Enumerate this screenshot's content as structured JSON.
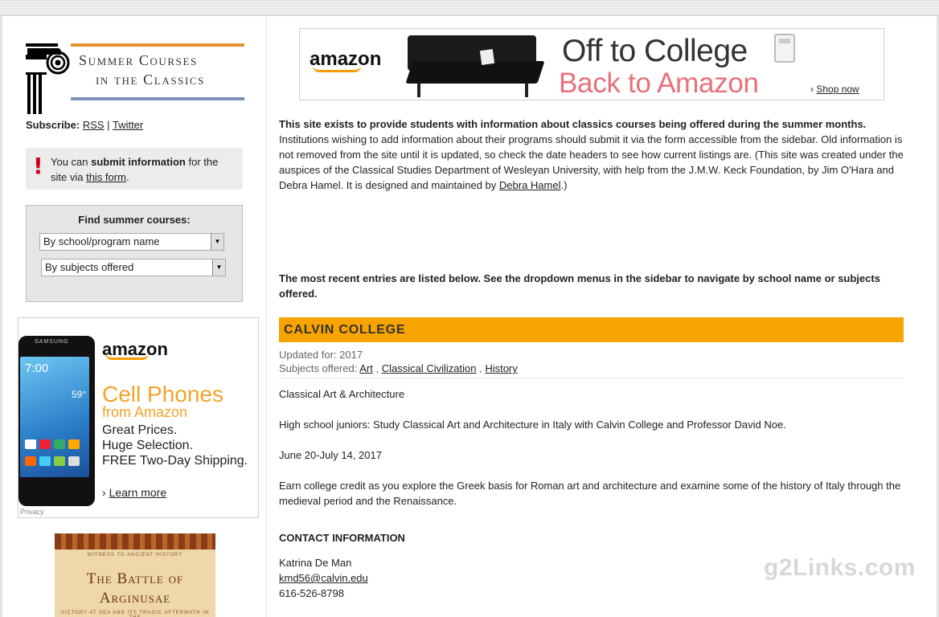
{
  "header": {
    "logo_line1": "Summer Courses",
    "logo_line2": "in the Classics"
  },
  "subscribe": {
    "label": "Subscribe:",
    "rss": "RSS",
    "separator": "|",
    "twitter": "Twitter"
  },
  "notice": {
    "text_pre": "You can",
    "text_bold": "submit information",
    "text_mid": "for the site via",
    "link": "this form",
    "text_post": "."
  },
  "finder": {
    "title": "Find summer courses:",
    "select_school": "By school/program name",
    "select_subjects": "By subjects offered"
  },
  "sidebar_ad": {
    "brand": "amazon",
    "phone_brand": "SAMSUNG",
    "phone_time": "7:00",
    "phone_temp": "59°",
    "headline": "Cell Phones",
    "sub": "from Amazon",
    "line1": "Great Prices.",
    "line2": "Huge Selection.",
    "line3": "FREE Two-Day Shipping.",
    "cta": "Learn more",
    "privacy": "Privacy"
  },
  "book": {
    "series": "WITNESS TO ANCIENT HISTORY",
    "title1": "The Battle of",
    "title2": "Arginusae",
    "desc": "VICTORY AT SEA AND ITS TRAGIC AFTERMATH IN THE"
  },
  "top_ad": {
    "brand": "amazon",
    "line1": "Off to College",
    "line2": "Back to Amazon",
    "cta": "Shop now"
  },
  "intro": {
    "bold": "This site exists to provide students with information about classics courses being offered during the summer months.",
    "body": "Institutions wishing to add information about their programs should submit it via the form accessible from the sidebar. Old information is not removed from the site until it is updated, so check the date headers to see how current listings are. (This site was created under the auspices of the Classical Studies Department of Wesleyan University, with help from the J.M.W. Keck Foundation, by Jim O'Hara and Debra Hamel. It is designed and maintained by",
    "link": "Debra Hamel",
    "end": ".)"
  },
  "recent_note": "The most recent entries are listed below. See the dropdown menus in the sidebar to navigate by school name or subjects offered.",
  "entry": {
    "title": "CALVIN COLLEGE",
    "updated_label": "Updated for:",
    "updated_value": "2017",
    "subjects_label": "Subjects offered:",
    "subjects": [
      "Art",
      "Classical Civilization",
      "History"
    ],
    "p1": "Classical Art & Architecture",
    "p2": "High school juniors: Study Classical Art and Architecture in Italy with Calvin College and Professor David Noe.",
    "p3": "June 20-July 14, 2017",
    "p4": "Earn college credit as you explore the Greek basis for Roman art and architecture and examine some of the history of Italy through the medieval period and the Renaissance.",
    "contact_heading": "CONTACT INFORMATION",
    "contact_name": "Katrina De Man",
    "contact_email": "kmd56@calvin.edu",
    "contact_phone": "616-526-8798"
  },
  "watermark": "g2Links.com",
  "colors": {
    "accent_orange": "#f8a300",
    "logo_orange": "#e7922f",
    "logo_blue": "#7a91b8",
    "alert_red": "#d0021b"
  }
}
